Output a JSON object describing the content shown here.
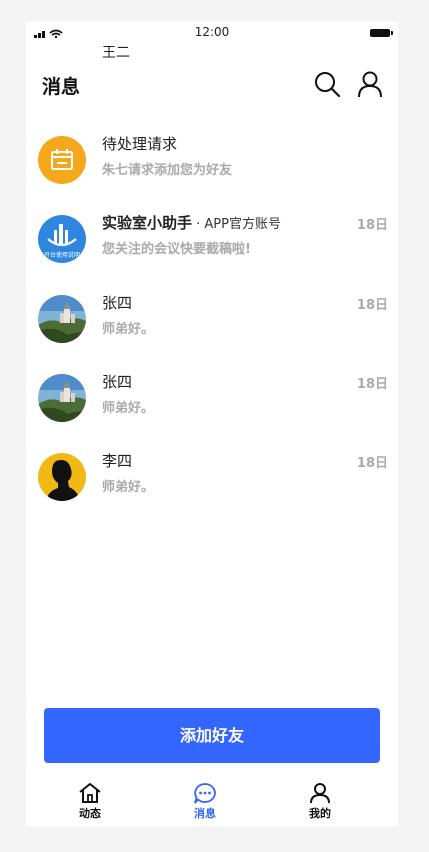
{
  "status_bar": {
    "time": "12:00"
  },
  "header": {
    "username": "王二",
    "title": "消息"
  },
  "messages": [
    {
      "name": "待处理请求",
      "preview": "朱七请求添加您为好友",
      "date": "",
      "avatar": "calendar-icon"
    },
    {
      "name": "实验室小助手",
      "badge": " · APP官方账号",
      "preview": "您关注的会议快要截稿啦!",
      "date": "18日",
      "avatar": "lab-assistant-logo",
      "avatar_text": "开台使用说明"
    },
    {
      "name": "张四",
      "preview": "师弟好。",
      "date": "18日",
      "avatar": "castle-photo"
    },
    {
      "name": "张四",
      "preview": "师弟好。",
      "date": "18日",
      "avatar": "castle-photo"
    },
    {
      "name": "李四",
      "preview": "师弟好。",
      "date": "18日",
      "avatar": "silhouette-portrait"
    }
  ],
  "add_friend_button": "添加好友",
  "tabs": [
    {
      "label": "动态",
      "icon": "home-icon"
    },
    {
      "label": "消息",
      "icon": "chat-icon",
      "active": true
    },
    {
      "label": "我的",
      "icon": "profile-icon"
    }
  ],
  "colors": {
    "accent": "#3366ff",
    "calendar_bg": "#f5a81c",
    "lab_bg": "#2e86de",
    "portrait_bg": "#f2b916"
  }
}
